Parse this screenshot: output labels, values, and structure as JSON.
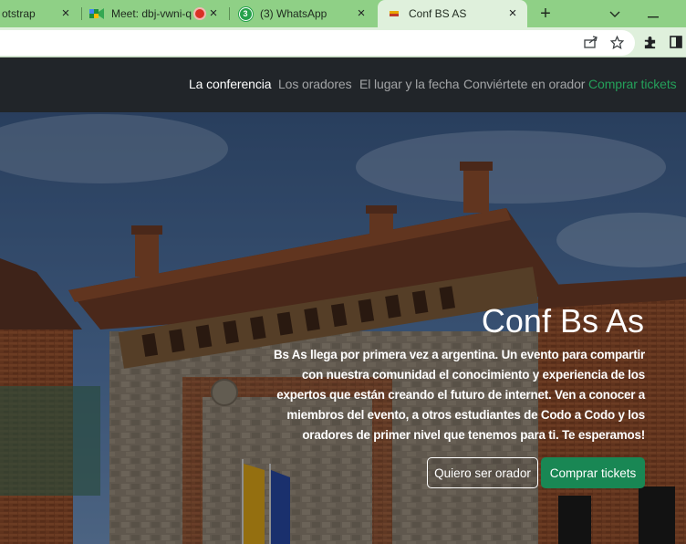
{
  "browser": {
    "tabs": [
      {
        "title": "otstrap",
        "icon": "bootstrap-icon"
      },
      {
        "title": "Meet: dbj-vwni-q",
        "icon": "google-meet-icon",
        "recording": true
      },
      {
        "title": "(3) WhatsApp",
        "icon": "whatsapp-icon",
        "badge": "3"
      },
      {
        "title": "Conf BS AS",
        "icon": "site-favicon",
        "active": true
      }
    ],
    "close_glyph": "×",
    "new_tab_glyph": "+",
    "strip_controls": [
      "chevron-down-icon",
      "minimize-icon"
    ],
    "toolbar_icons": [
      "share-icon",
      "star-icon",
      "extensions-icon",
      "sidebar-icon"
    ]
  },
  "nav": {
    "links": [
      {
        "label": "La conferencia",
        "state": "active"
      },
      {
        "label": "Los oradores",
        "state": "normal"
      },
      {
        "label": "El lugar y la fecha",
        "state": "normal"
      },
      {
        "label": "Conviértete en orador",
        "state": "normal"
      },
      {
        "label": "Comprar tickets",
        "state": "cta"
      }
    ]
  },
  "hero": {
    "title": "Conf Bs As",
    "text": "Bs As llega por primera vez a argentina. Un evento para compartir con nuestra comunidad el conocimiento y experiencia de los expertos que están creando el futuro de internet. Ven a conocer a miembros del evento, a otros estudiantes de Codo a Codo y los oradores de primer nivel que tenemos para ti. Te esperamos!",
    "buttons": {
      "speaker": "Quiero ser orador",
      "tickets": "Comprar tickets"
    }
  },
  "colors": {
    "nav_bg": "#212529",
    "cta_green": "#198754",
    "nav_cta_text": "#24a05a",
    "browser_frame": "#8fd086"
  }
}
